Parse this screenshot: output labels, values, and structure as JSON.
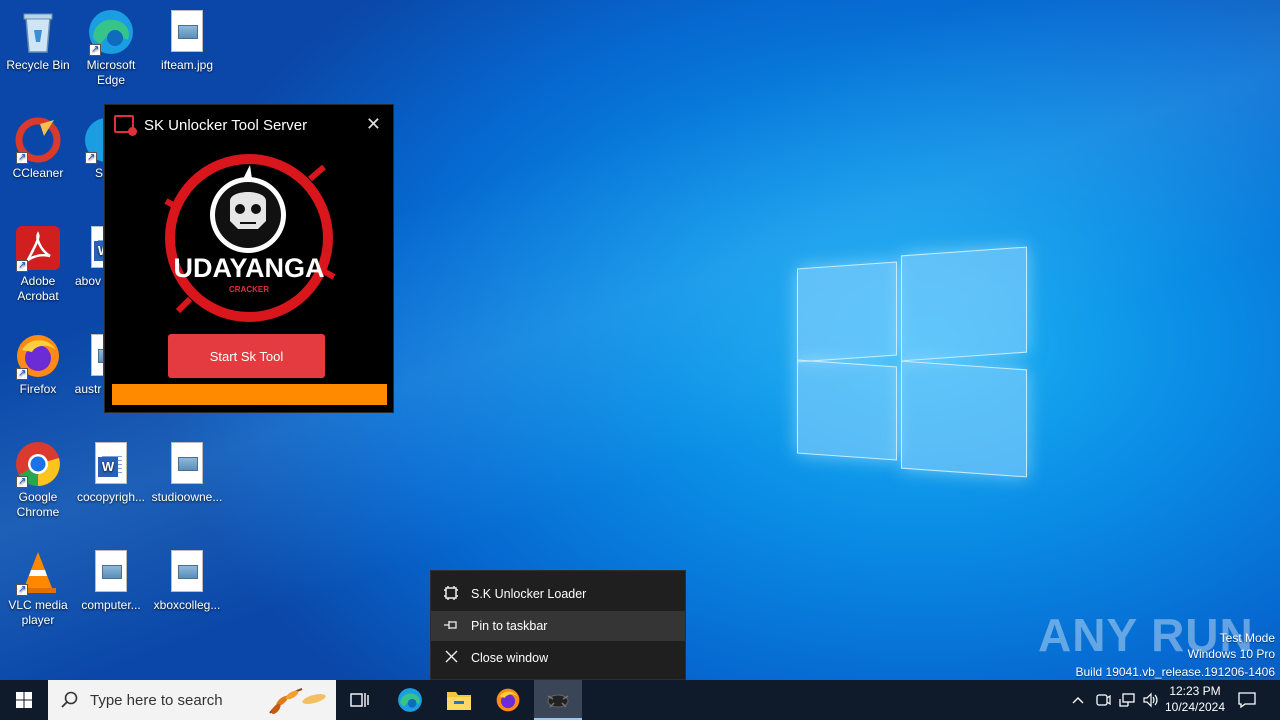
{
  "desktop": {
    "icons": [
      {
        "label": "Recycle Bin"
      },
      {
        "label": "Microsoft Edge"
      },
      {
        "label": "ifteam.jpg"
      },
      {
        "label": "CCleaner"
      },
      {
        "label": "S"
      },
      {
        "label": "Adobe Acrobat"
      },
      {
        "label": "abov"
      },
      {
        "label": "Firefox"
      },
      {
        "label": "austr"
      },
      {
        "label": "Google Chrome"
      },
      {
        "label": "cocopyrigh..."
      },
      {
        "label": "studioowne..."
      },
      {
        "label": "VLC media player"
      },
      {
        "label": "computer..."
      },
      {
        "label": "xboxcolleg..."
      }
    ]
  },
  "app_window": {
    "title": "SK Unlocker Tool Server",
    "close_glyph": "✕",
    "logo_text": "UDAYANGA",
    "logo_subtext": "CRACKER",
    "start_button": "Start Sk Tool",
    "progress_fraction": 1.0,
    "accent_color": "#e33b3f",
    "progress_color": "#ff8a00"
  },
  "jumplist": {
    "items": [
      {
        "label": "S.K Unlocker Loader",
        "icon": "app-icon"
      },
      {
        "label": "Pin to taskbar",
        "icon": "pin-icon"
      },
      {
        "label": "Close window",
        "icon": "close-icon"
      }
    ]
  },
  "watermark": {
    "text": "ANY RUN",
    "mode": "Test Mode",
    "edition": "Windows 10 Pro",
    "build": "Build 19041.vb_release.191206-1406"
  },
  "taskbar": {
    "search_placeholder": "Type here to search",
    "time": "12:23 PM",
    "date": "10/24/2024"
  }
}
